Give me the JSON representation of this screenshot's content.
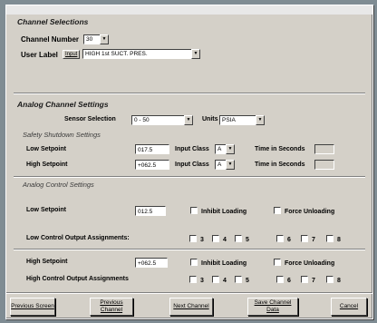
{
  "channel_selections": {
    "title": "Channel Selections",
    "channel_number_label": "Channel Number",
    "channel_number_value": "30",
    "user_label_label": "User Label",
    "user_label_button": "Input",
    "user_label_value": "HIGH 1st SUCT. PRES."
  },
  "analog_settings": {
    "title": "Analog Channel Settings",
    "sensor_selection_label": "Sensor Selection",
    "sensor_selection_value": "0 - 50",
    "units_label": "Units",
    "units_value": "PSIA"
  },
  "safety_shutdown": {
    "title": "Safety Shutdown Settings",
    "low_setpoint_label": "Low Setpoint",
    "low_setpoint_value": "017.5",
    "high_setpoint_label": "High Setpoint",
    "high_setpoint_value": "+062.5",
    "input_class_label": "Input Class",
    "low_input_class": "A",
    "high_input_class": "A",
    "time_seconds_label": "Time in Seconds"
  },
  "analog_control": {
    "title": "Analog Control Settings",
    "low_setpoint_label": "Low Setpoint",
    "low_setpoint_value": "012.5",
    "high_setpoint_label": "High Setpoint",
    "high_setpoint_value": "+062.5",
    "inhibit_loading": "Inhibit Loading",
    "force_unloading": "Force Unloading",
    "low_outputs_label": "Low Control Output Assignments:",
    "high_outputs_label": "High Control Output Assignments",
    "outputs": [
      "3",
      "4",
      "5",
      "6",
      "7",
      "8"
    ]
  },
  "buttons": {
    "previous_screen": "Previous Screen",
    "previous_channel": "Previous Channel",
    "next_channel": "Next Channel",
    "save_channel_data": "Save Channel Data",
    "cancel": "Cancel"
  }
}
